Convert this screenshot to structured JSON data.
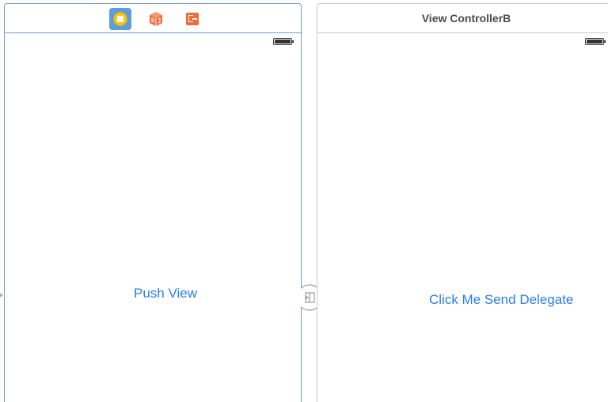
{
  "scene_a": {
    "dock": {
      "icons": [
        "view-controller-icon",
        "first-responder-icon",
        "exit-icon"
      ]
    },
    "button_label": "Push View"
  },
  "scene_b": {
    "title": "View ControllerB",
    "button_label": "Click Me Send Delegate"
  },
  "segue": {
    "icon": "segue-icon"
  },
  "colors": {
    "selection_border": "#6e9fd6",
    "button_text": "#2b7de9",
    "exit_icon": "#ef6c3a",
    "cube_icon": "#ef6c3a",
    "vc_icon_background": "#5b9ee0",
    "vc_icon_circle": "#f5c518"
  }
}
